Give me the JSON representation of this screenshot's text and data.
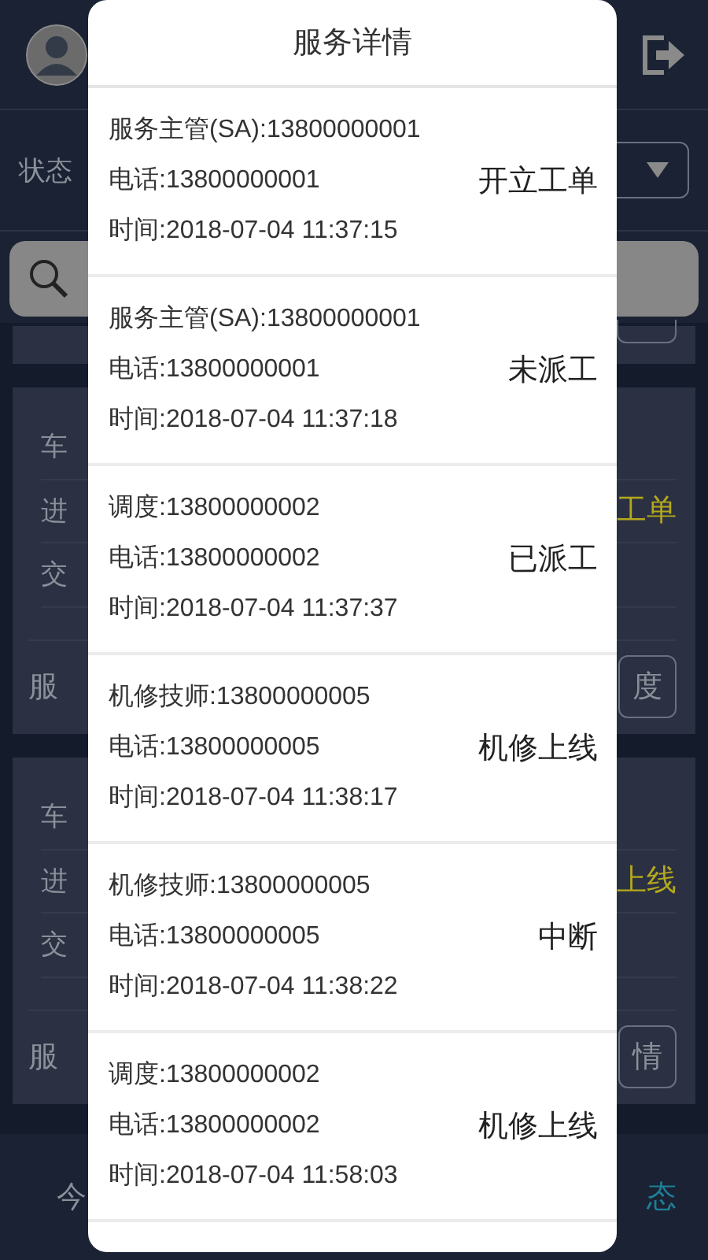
{
  "background": {
    "status_label": "状态",
    "cards": [
      {
        "plate_label": "车",
        "in_label": "进",
        "out_label": "交",
        "status": "工单",
        "service_label": "服",
        "action": "度"
      },
      {
        "plate_label": "车",
        "in_label": "进",
        "out_label": "交",
        "status": "上线",
        "service_label": "服",
        "action": "情"
      }
    ],
    "tabs": [
      {
        "label": "今",
        "selected": false
      },
      {
        "label": "态",
        "selected": true
      }
    ]
  },
  "dialog": {
    "title": "服务详情",
    "records": [
      {
        "role": "服务主管(SA):13800000001",
        "phone": "电话:13800000001",
        "time": "时间:2018-07-04 11:37:15",
        "status": "开立工单"
      },
      {
        "role": "服务主管(SA):13800000001",
        "phone": "电话:13800000001",
        "time": "时间:2018-07-04 11:37:18",
        "status": "未派工"
      },
      {
        "role": "调度:13800000002",
        "phone": "电话:13800000002",
        "time": "时间:2018-07-04 11:37:37",
        "status": "已派工"
      },
      {
        "role": "机修技师:13800000005",
        "phone": "电话:13800000005",
        "time": "时间:2018-07-04 11:38:17",
        "status": "机修上线"
      },
      {
        "role": "机修技师:13800000005",
        "phone": "电话:13800000005",
        "time": "时间:2018-07-04 11:38:22",
        "status": "中断"
      },
      {
        "role": "调度:13800000002",
        "phone": "电话:13800000002",
        "time": "时间:2018-07-04 11:58:03",
        "status": "机修上线"
      }
    ]
  }
}
